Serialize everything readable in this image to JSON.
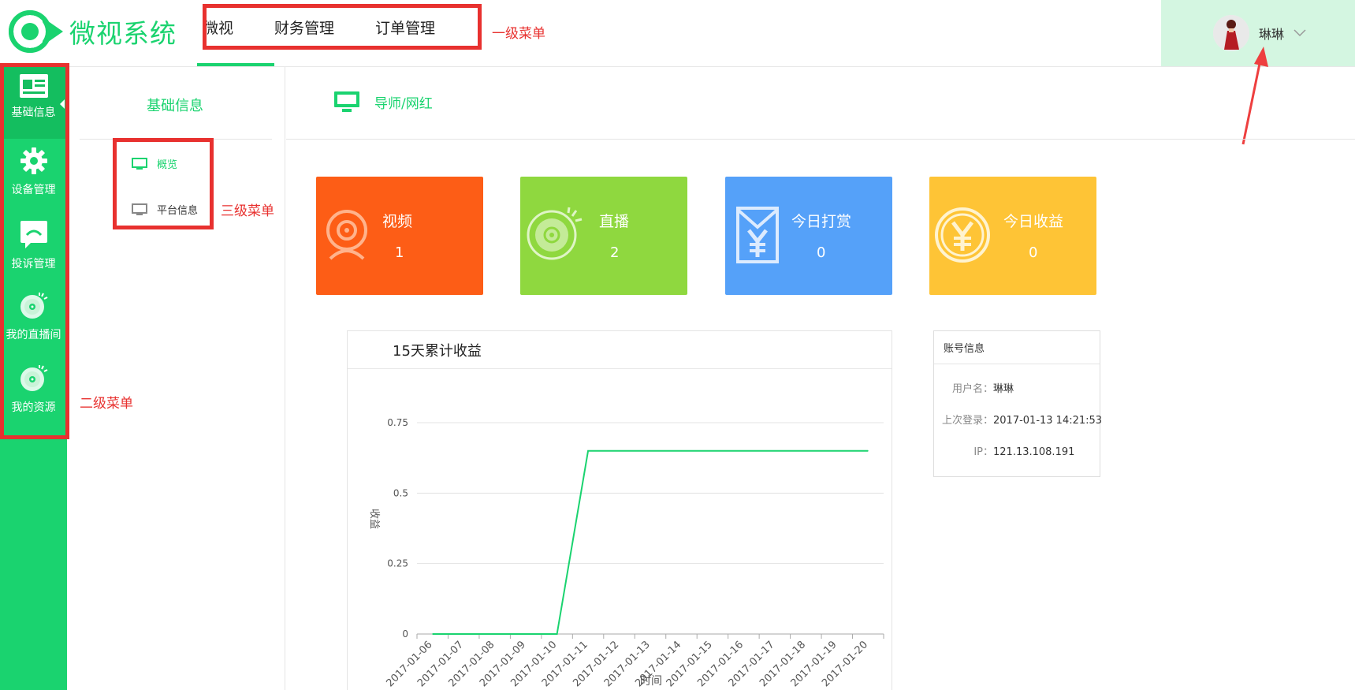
{
  "app": {
    "title": "微视系统"
  },
  "top_nav": {
    "items": [
      "微视",
      "财务管理",
      "订单管理"
    ],
    "active_index": 0
  },
  "annotations": {
    "level1": "一级菜单",
    "level2": "二级菜单",
    "level3": "三级菜单"
  },
  "user": {
    "name": "琳琳"
  },
  "sidebar": {
    "items": [
      {
        "label": "基础信息",
        "icon": "id-card-icon",
        "active": true
      },
      {
        "label": "设备管理",
        "icon": "gear-icon",
        "active": false
      },
      {
        "label": "投诉管理",
        "icon": "complaint-chat-icon",
        "active": false
      },
      {
        "label": "我的直播间",
        "icon": "live-disc-icon",
        "active": false
      },
      {
        "label": "我的资源",
        "icon": "resource-disc-icon",
        "active": false
      }
    ]
  },
  "menu3": {
    "title": "基础信息",
    "items": [
      {
        "label": "概览",
        "icon": "monitor-icon",
        "active": true
      },
      {
        "label": "平台信息",
        "icon": "monitor-icon",
        "active": false
      }
    ]
  },
  "main_header": {
    "label": "导师/网红",
    "icon": "monitor-icon"
  },
  "cards": [
    {
      "title": "视频",
      "value": "1",
      "color": "#fd5d16",
      "icon": "webcam-icon"
    },
    {
      "title": "直播",
      "value": "2",
      "color": "#8fd83f",
      "icon": "live-disc-icon"
    },
    {
      "title": "今日打赏",
      "value": "0",
      "color": "#55a1f9",
      "icon": "yen-envelope-icon"
    },
    {
      "title": "今日收益",
      "value": "0",
      "color": "#fec436",
      "icon": "yen-coin-icon"
    }
  ],
  "chart_data": {
    "type": "line",
    "title": "15天累计收益",
    "xlabel": "时间",
    "ylabel": "收益",
    "categories": [
      "2017-01-06",
      "2017-01-07",
      "2017-01-08",
      "2017-01-09",
      "2017-01-10",
      "2017-01-11",
      "2017-01-12",
      "2017-01-13",
      "2017-01-14",
      "2017-01-15",
      "2017-01-16",
      "2017-01-17",
      "2017-01-18",
      "2017-01-19",
      "2017-01-20"
    ],
    "series": [
      {
        "values": [
          0,
          0,
          0,
          0,
          0,
          0.65,
          0.65,
          0.65,
          0.65,
          0.65,
          0.65,
          0.65,
          0.65,
          0.65,
          0.65
        ]
      }
    ],
    "yticks": [
      "0",
      "0.25",
      "0.5",
      "0.75"
    ],
    "ylim": [
      0,
      0.75
    ],
    "grid": true,
    "line_color": "#1ad36f"
  },
  "account": {
    "title": "账号信息",
    "rows": [
      {
        "key": "用户名：",
        "value": "琳琳"
      },
      {
        "key": "上次登录：",
        "value": "2017-01-13 14:21:53"
      },
      {
        "key": "IP：",
        "value": "121.13.108.191"
      }
    ]
  },
  "colors": {
    "brand": "#1ad36f",
    "annotation": "#e8312f",
    "user_bg": "#d4f6e1"
  }
}
